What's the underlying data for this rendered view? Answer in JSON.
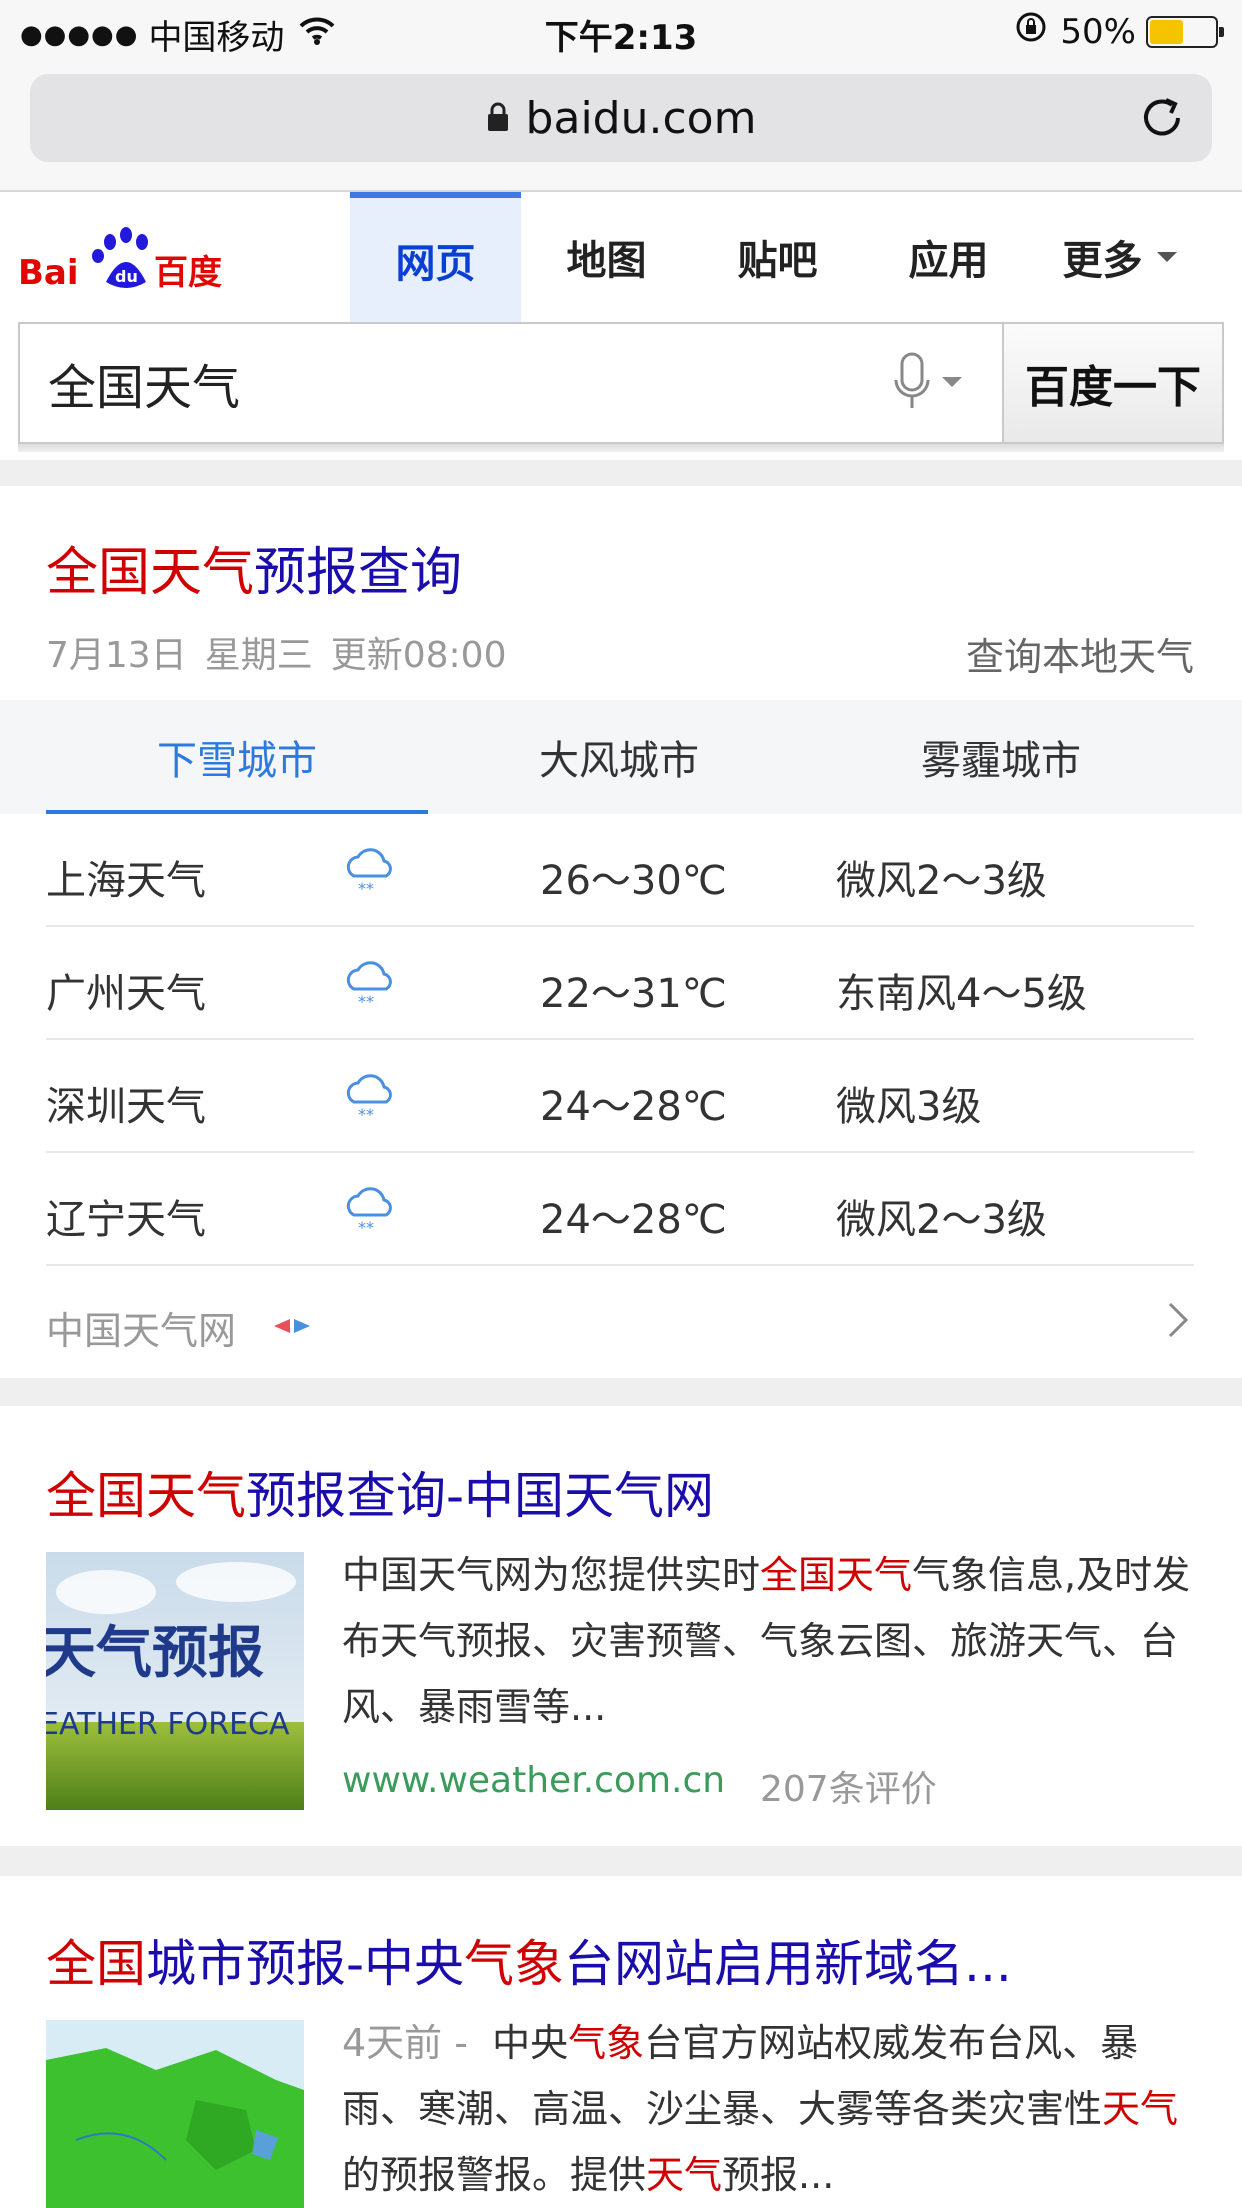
{
  "status_bar": {
    "signal": "●●●●●",
    "carrier": "中国移动",
    "time": "下午2:13",
    "battery": "50%",
    "battery_level": 0.5
  },
  "browser": {
    "url": "baidu.com"
  },
  "baidu": {
    "logo_text": "Bai百度",
    "nav_tabs": [
      {
        "label": "网页"
      },
      {
        "label": "地图"
      },
      {
        "label": "贴吧"
      },
      {
        "label": "应用"
      },
      {
        "label": "更多"
      }
    ],
    "search_query": "全国天气",
    "search_button": "百度一下"
  },
  "weather_card": {
    "title_highlight": "全国天气",
    "title_rest": "预报查询",
    "date": "7月13日",
    "weekday": "星期三",
    "updated": "更新08:00",
    "local_link": "查询本地天气",
    "tabs": [
      {
        "label": "下雪城市"
      },
      {
        "label": "大风城市"
      },
      {
        "label": "雾霾城市"
      }
    ],
    "rows": [
      {
        "city": "上海天气",
        "icon": "snow-cloud-icon",
        "temp": "26～30℃",
        "wind": "微风2～3级"
      },
      {
        "city": "广州天气",
        "icon": "snow-cloud-icon",
        "temp": "22～31℃",
        "wind": "东南风4～5级"
      },
      {
        "city": "深圳天气",
        "icon": "snow-cloud-icon",
        "temp": "24～28℃",
        "wind": "微风3级"
      },
      {
        "city": "辽宁天气",
        "icon": "snow-cloud-icon",
        "temp": "24～28℃",
        "wind": "微风2～3级"
      }
    ],
    "source": "中国天气网"
  },
  "results": [
    {
      "title_hl": "全国天气",
      "title_rest": "预报查询-中国天气网",
      "thumb_text": "天气预报",
      "thumb_text_en": "EATHER FORECA",
      "desc_parts": [
        "中国天气网为您提供实时",
        "全国天气",
        "气象信息,及时发布天气预报、灾害预警、气象云图、旅游天气、台风、暴雨雪等..."
      ],
      "url": "www.weather.com.cn",
      "rating": "207条评价"
    },
    {
      "title_parts": [
        "全国",
        "城市预报-中央",
        "气象",
        "台网站启用新域名..."
      ],
      "date": "4天前 -",
      "desc_parts": [
        "中央",
        "气象",
        "台官方网站权威发布台风、暴雨、寒潮、高温、沙尘暴、大雾等各类灾害性",
        "天气",
        "的预报警报。提供",
        "天气",
        "预报..."
      ]
    }
  ],
  "colors": {
    "link": "#1a0dab",
    "highlight": "#d00000",
    "tab_active": "#2c7ae0",
    "url_green": "#3b9b5a"
  }
}
